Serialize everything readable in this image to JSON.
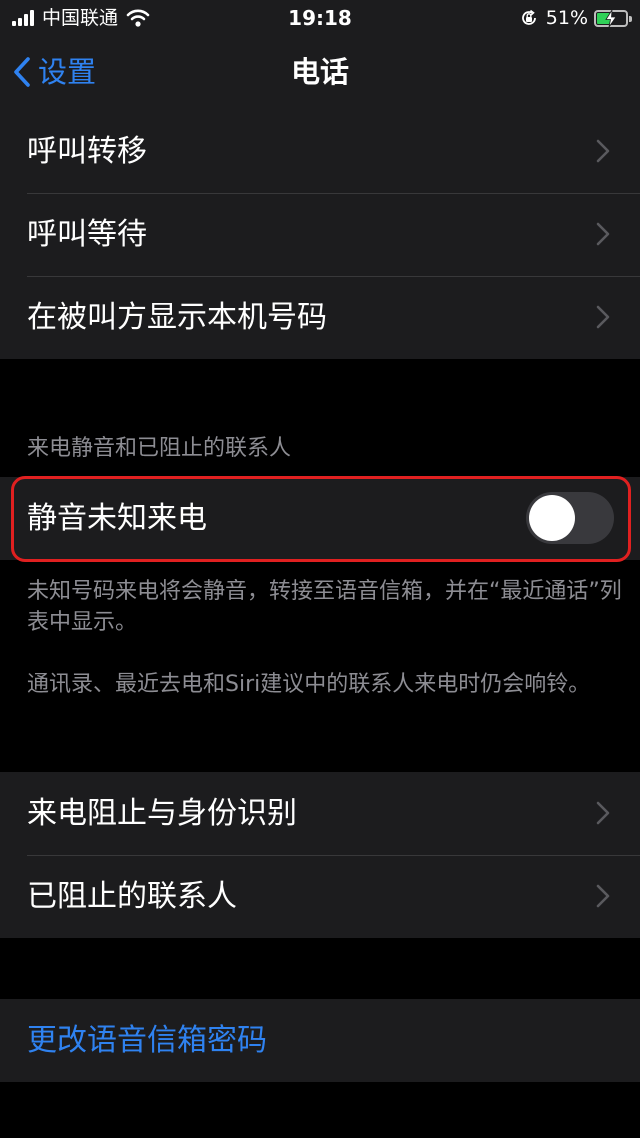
{
  "status_bar": {
    "carrier": "中国联通",
    "time": "19:18",
    "battery_percent": "51%",
    "battery_level": 0.51,
    "icons": [
      "signal-icon",
      "wifi-icon",
      "orientation-lock-icon",
      "battery-charging-icon"
    ]
  },
  "nav": {
    "back_label": "设置",
    "title": "电话"
  },
  "group1": {
    "items": [
      {
        "label": "呼叫转移"
      },
      {
        "label": "呼叫等待"
      },
      {
        "label": "在被叫方显示本机号码"
      }
    ]
  },
  "silence_section": {
    "header": "来电静音和已阻止的联系人",
    "toggle_label": "静音未知来电",
    "toggle_on": false,
    "footer1": "未知号码来电将会静音，转接至语音信箱，并在“最近通话”列表中显示。",
    "footer2": "通讯录、最近去电和Siri建议中的联系人来电时仍会响铃。"
  },
  "group2": {
    "items": [
      {
        "label": "来电阻止与身份识别"
      },
      {
        "label": "已阻止的联系人"
      }
    ]
  },
  "group3": {
    "link_label": "更改语音信箱密码"
  },
  "colors": {
    "accent": "#2f82f0",
    "background": "#000000",
    "cell_background": "#1c1c1e",
    "secondary_text": "#8d8d93",
    "highlight": "#e02020",
    "battery_fill": "#30d158"
  }
}
